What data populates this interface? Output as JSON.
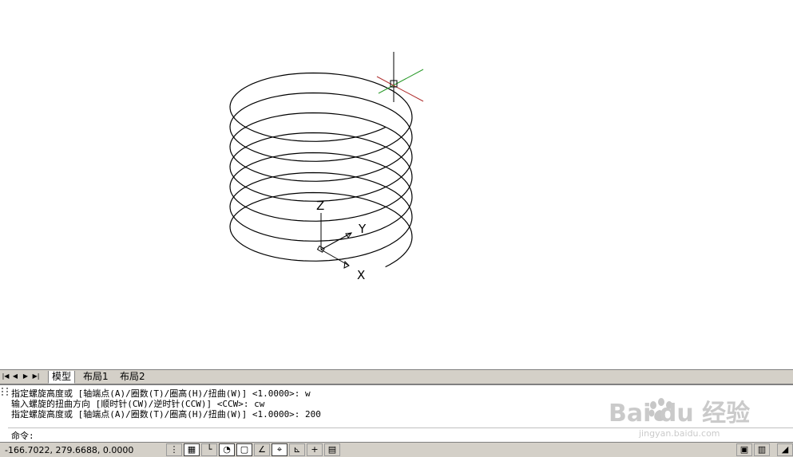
{
  "ucs": {
    "z_label": "Z",
    "y_label": "Y",
    "x_label": "X"
  },
  "layout_tabs": [
    "模型",
    "布局1",
    "布局2"
  ],
  "active_tab": "模型",
  "nav_buttons": [
    "|◀",
    "◀",
    "▶",
    "▶|"
  ],
  "command_history": [
    "指定螺旋高度或 [轴端点(A)/圈数(T)/圈高(H)/扭曲(W)] <1.0000>: w",
    "输入螺旋的扭曲方向 [顺时针(CW)/逆时针(CCW)] <CCW>: cw",
    "指定螺旋高度或 [轴端点(A)/圈数(T)/圈高(H)/扭曲(W)] <1.0000>: 200"
  ],
  "command_prompt": "命令:",
  "status": {
    "coordinates": "-166.7022, 279.6688, 0.0000",
    "toggles": [
      {
        "name": "snap-toggle",
        "icon": "snap-icon",
        "on": false
      },
      {
        "name": "grid-toggle",
        "icon": "grid-icon",
        "on": true
      },
      {
        "name": "ortho-toggle",
        "icon": "ortho-icon",
        "on": false
      },
      {
        "name": "polar-toggle",
        "icon": "polar-icon",
        "on": true
      },
      {
        "name": "osnap-toggle",
        "icon": "osnap-icon",
        "on": true
      },
      {
        "name": "3d-osnap-toggle",
        "icon": "3d-osnap-icon",
        "on": false
      },
      {
        "name": "otrack-toggle",
        "icon": "otrack-icon",
        "on": true
      },
      {
        "name": "ducs-toggle",
        "icon": "ducs-icon",
        "on": false
      },
      {
        "name": "dyn-toggle",
        "icon": "dyn-icon",
        "on": false
      },
      {
        "name": "lwt-toggle",
        "icon": "lwt-icon",
        "on": false
      }
    ]
  },
  "watermark": {
    "brand": "Bai du 经验",
    "url": "jingyan.baidu.com"
  },
  "colors": {
    "crosshair_red": "#b03030",
    "crosshair_green": "#2a9a2a",
    "helix": "#000000",
    "panel": "#d4d0c8"
  }
}
